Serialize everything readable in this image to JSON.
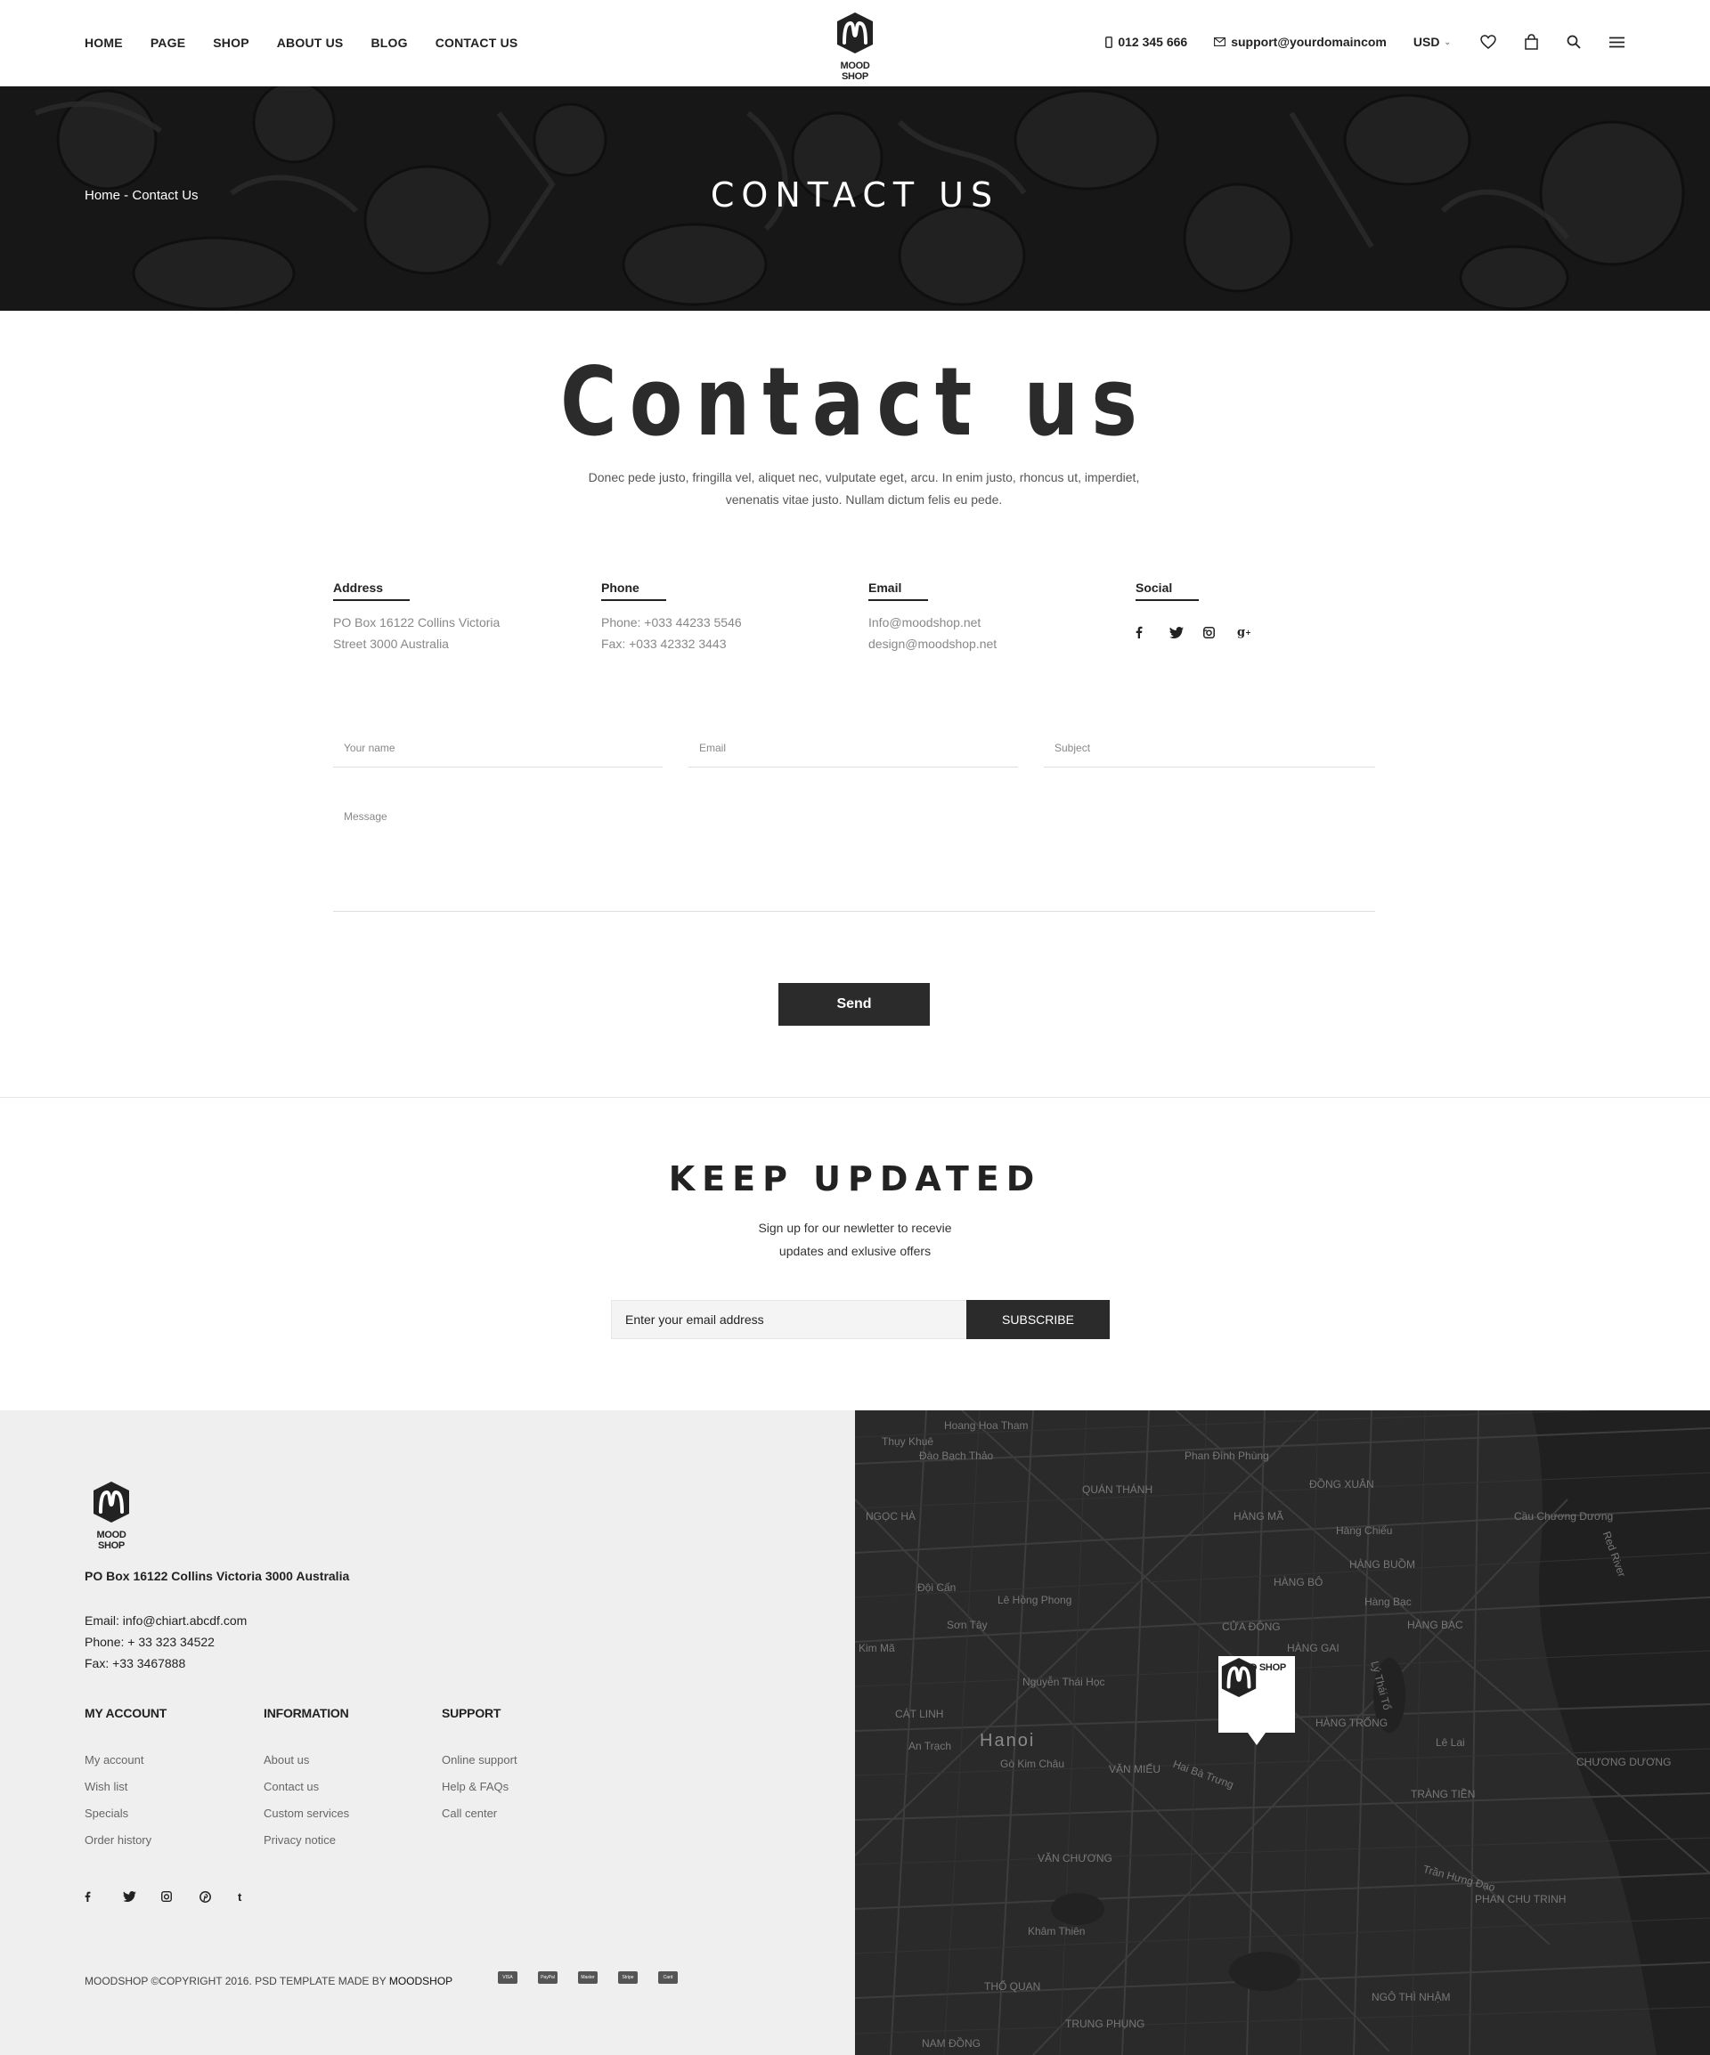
{
  "header": {
    "nav": [
      "HOME",
      "PAGE",
      "SHOP",
      "ABOUT US",
      "BLOG",
      "CONTACT US"
    ],
    "brand": "MOOD SHOP",
    "phone": "012 345 666",
    "email": "support@yourdomaincom",
    "currency": "USD",
    "icons": [
      "heart-icon",
      "bag-icon",
      "search-icon",
      "menu-icon"
    ]
  },
  "hero": {
    "title": "CONTACT US",
    "breadcrumb_home": "Home",
    "breadcrumb_sep": " - ",
    "breadcrumb_current": "Contact Us"
  },
  "contact": {
    "title": "Contact us",
    "intro": "Donec pede justo, fringilla vel, aliquet nec, vulputate eget, arcu. In enim justo, rhoncus ut, imperdiet, venenatis vitae justo. Nullam dictum felis eu pede.",
    "address": {
      "label": "Address",
      "line1": "PO Box 16122 Collins  Victoria",
      "line2": "Street 3000 Australia"
    },
    "phone": {
      "label": "Phone",
      "line1": "Phone: +033 44233 5546",
      "line2": "Fax: +033 42332 3443"
    },
    "email": {
      "label": "Email",
      "line1": "Info@moodshop.net",
      "line2": "design@moodshop.net"
    },
    "social": {
      "label": "Social",
      "icons": [
        "facebook-icon",
        "twitter-icon",
        "instagram-icon",
        "google-plus-icon"
      ]
    }
  },
  "form": {
    "name_placeholder": "Your name",
    "email_placeholder": "Email",
    "subject_placeholder": "Subject",
    "message_placeholder": "Message",
    "send_label": "Send"
  },
  "newsletter": {
    "title": "KEEP UPDATED",
    "line1": "Sign up for our newletter to recevie",
    "line2": "updates and exlusive offers",
    "placeholder": "Enter your email address",
    "button": "SUBSCRIBE"
  },
  "footer": {
    "brand": "MOOD SHOP",
    "address": "PO Box 16122 Collins  Victoria 3000 Australia",
    "email": "Email:  info@chiart.abcdf.com",
    "phone": "Phone:  + 33 323 34522",
    "fax": "Fax:  +33 3467888",
    "columns": [
      {
        "title": "MY ACCOUNT",
        "links": [
          "My account",
          "Wish list",
          "Specials",
          "Order history"
        ]
      },
      {
        "title": "INFORMATION",
        "links": [
          "About us",
          "Contact us",
          "Custom services",
          "Privacy notice"
        ]
      },
      {
        "title": "SUPPORT",
        "links": [
          "Online support",
          "Help & FAQs",
          "Call center"
        ]
      }
    ],
    "social_icons": [
      "facebook-icon",
      "twitter-icon",
      "instagram-icon",
      "pinterest-icon",
      "tumblr-icon"
    ],
    "copyright": "MOODSHOP ©COPYRIGHT 2016. PSD TEMPLATE MADE BY ",
    "copyright_brand": "MOODSHOP",
    "payments": [
      "VISA",
      "PayPal",
      "Master",
      "Stripe",
      "Card"
    ]
  },
  "map": {
    "city": "Hanoi",
    "labels": [
      "Hoang Hoa Tham",
      "Thụy Khuê",
      "Đào Bạch Thảo",
      "Phan Đình Phùng",
      "QUÁN THÁNH",
      "ĐỒNG XUÂN",
      "NGỌC HÀ",
      "HÀNG MÃ",
      "Hàng Chiếu",
      "HÀNG BUỒM",
      "Cầu Chương Dương",
      "Đội Cấn",
      "Lê Hồng Phong",
      "HÀNG BÔ",
      "Hàng Bạc",
      "HÀNG BẠC",
      "Sơn Tây",
      "CỬA ĐÔNG",
      "HÀNG GAI",
      "Kim Mã",
      "Nguyễn Thái Học",
      "CÁT LINH",
      "HÀNG TRỐNG",
      "Lê Lai",
      "An Trạch",
      "Gò Kim Châu",
      "VĂN MIẾU",
      "TRÀNG TIỀN",
      "CHƯƠNG DƯƠNG",
      "VĂN CHƯƠNG",
      "Khâm Thiên",
      "PHAN CHU TRINH",
      "THỔ QUAN",
      "TRUNG PHỤNG",
      "NGÔ THÌ NHẬM",
      "NAM ĐỒNG",
      "Red River",
      "Hai Bà Trưng",
      "Trần Hưng Đạo",
      "Lý Thái Tổ"
    ]
  }
}
